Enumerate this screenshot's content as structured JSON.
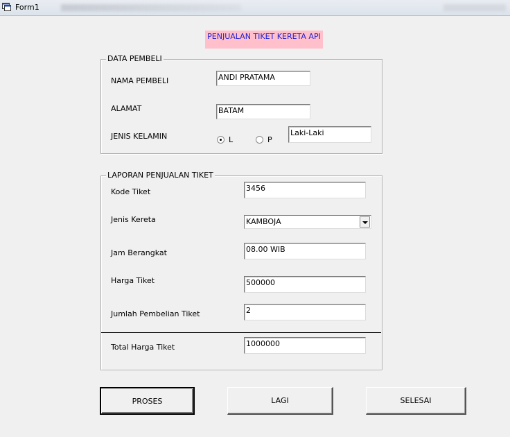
{
  "window": {
    "title": "Form1"
  },
  "heading": "PENJUALAN TIKET KERETA API",
  "pembeli": {
    "frame_title": "DATA PEMBELI",
    "nama_label": "NAMA PEMBELI",
    "nama_value": "ANDI PRATAMA",
    "alamat_label": "ALAMAT",
    "alamat_value": "BATAM",
    "jk_label": "JENIS KELAMIN",
    "radio_l": "L",
    "radio_p": "P",
    "jk_value": "Laki-Laki"
  },
  "laporan": {
    "frame_title": "LAPORAN PENJUALAN TIKET",
    "kode_label": "Kode Tiket",
    "kode_value": "3456",
    "jenis_label": "Jenis Kereta",
    "jenis_value": "KAMBOJA",
    "jam_label": "Jam Berangkat",
    "jam_value": "08.00 WIB",
    "harga_label": "Harga Tiket",
    "harga_value": "500000",
    "jumlah_label": "Jumlah Pembelian Tiket",
    "jumlah_value": "2",
    "total_label": "Total Harga Tiket",
    "total_value": "1000000"
  },
  "buttons": {
    "proses": "PROSES",
    "lagi": "LAGI",
    "selesai": "SELESAI"
  }
}
